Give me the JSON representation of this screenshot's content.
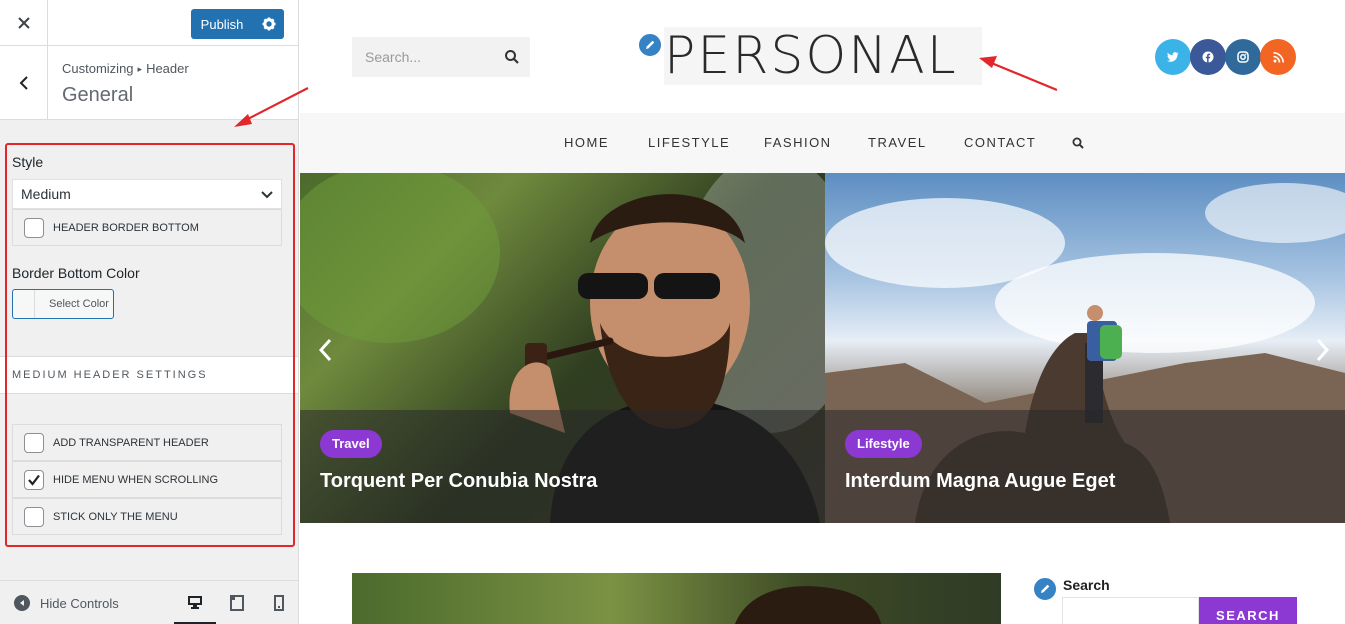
{
  "customizer": {
    "close_icon": "close-icon",
    "publish_label": "Publish",
    "breadcrumb": {
      "root": "Customizing",
      "separator": "▸",
      "section": "Header"
    },
    "section_title": "General",
    "style": {
      "label": "Style",
      "selected": "Medium",
      "header_border_bottom": {
        "label": "HEADER BORDER BOTTOM",
        "checked": false
      }
    },
    "border_bottom_color": {
      "label": "Border Bottom Color",
      "button": "Select Color"
    },
    "medium_header_settings": {
      "heading": "MEDIUM HEADER SETTINGS",
      "options": [
        {
          "label": "ADD TRANSPARENT HEADER",
          "checked": false
        },
        {
          "label": "HIDE MENU WHEN SCROLLING",
          "checked": true
        },
        {
          "label": "STICK ONLY THE MENU",
          "checked": false
        }
      ]
    },
    "footer": {
      "hide_controls": "Hide Controls",
      "devices": [
        "desktop-icon",
        "tablet-icon",
        "mobile-icon"
      ]
    }
  },
  "site": {
    "search_placeholder": "Search...",
    "logo_text": "PERSONAL",
    "socials": [
      {
        "icon": "twitter-icon",
        "color": "#3bb2e8"
      },
      {
        "icon": "facebook-icon",
        "color": "#3b5998"
      },
      {
        "icon": "instagram-icon",
        "color": "#2f6a9a"
      },
      {
        "icon": "rss-icon",
        "color": "#f26522"
      }
    ],
    "nav": [
      "HOME",
      "LIFESTYLE",
      "FASHION",
      "TRAVEL",
      "CONTACT"
    ],
    "slides": [
      {
        "tag": "Travel",
        "title": "Torquent Per Conubia Nostra"
      },
      {
        "tag": "Lifestyle",
        "title": "Interdum Magna Augue Eget"
      }
    ],
    "sidebar_widget": {
      "title": "Search",
      "button": "SEARCH"
    }
  },
  "colors": {
    "accent": "#2271b1",
    "tag": "#8c39d4",
    "highlight": "#e3262a"
  }
}
